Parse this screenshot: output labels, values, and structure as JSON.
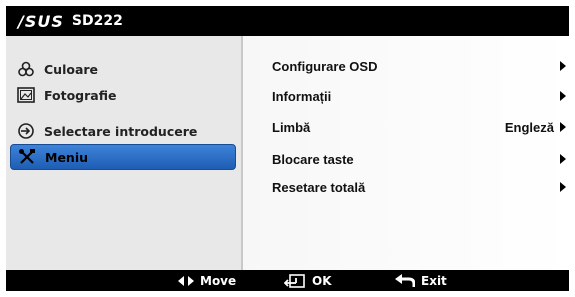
{
  "title": {
    "brand": "/SUS",
    "model": "SD222"
  },
  "left_menu": [
    {
      "label": "Culoare",
      "icon": "color-icon"
    },
    {
      "label": "Fotografie",
      "icon": "image-icon"
    },
    {
      "label": "Selectare introducere",
      "icon": "input-icon"
    },
    {
      "label": "Meniu",
      "icon": "tools-icon",
      "selected": true
    }
  ],
  "right_menu": [
    {
      "label": "Configurare OSD",
      "value": ""
    },
    {
      "label": "Informații",
      "value": ""
    },
    {
      "label": "Limbă",
      "value": "Engleză"
    },
    {
      "label": "Blocare taste",
      "value": ""
    },
    {
      "label": "Resetare totală",
      "value": ""
    }
  ],
  "footer": {
    "move": "Move",
    "ok": "OK",
    "exit": "Exit"
  },
  "colors": {
    "selected": "#2b6fc7",
    "frame": "#000000",
    "panel": "#e8e8e8"
  }
}
